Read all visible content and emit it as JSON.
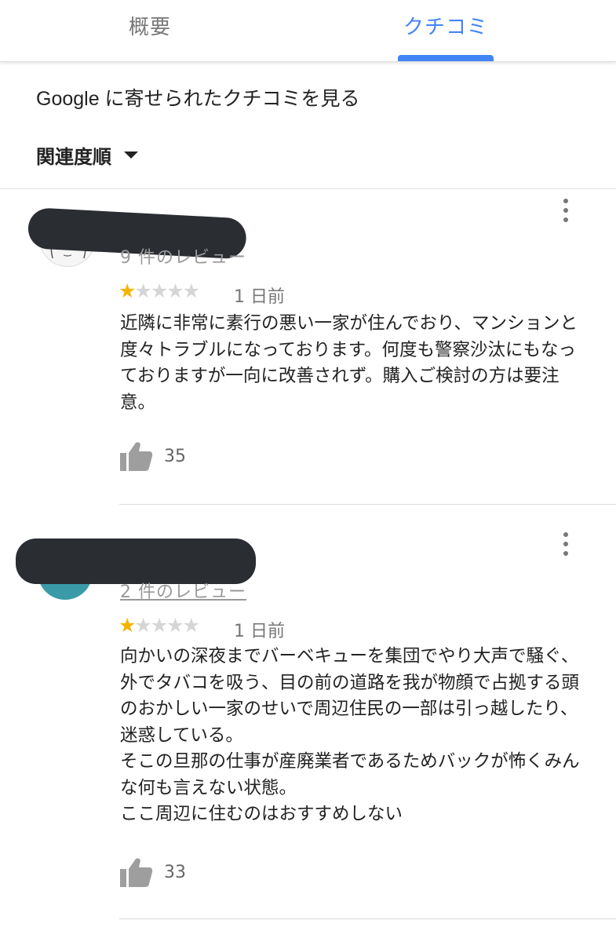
{
  "tabs": [
    {
      "label": "概要"
    },
    {
      "label": "クチコミ"
    }
  ],
  "heading": "Google に寄せられたクチコミを見る",
  "sort": {
    "label": "関連度順"
  },
  "reviews": [
    {
      "review_count": "9 件のレビュー",
      "rating": 1,
      "max_rating": 5,
      "stars_text": {
        "on": "★",
        "off": "★★★★"
      },
      "date": "1 日前",
      "text": "近隣に非常に素行の悪い一家が住んでおり、マンションと度々トラブルになっております。何度も警察沙汰にもなっておりますが一向に改善されず。購入ご検討の方は要注意。",
      "likes": "35"
    },
    {
      "review_count": "2 件のレビュー",
      "rating": 1,
      "max_rating": 5,
      "stars_text": {
        "on": "★",
        "off": "★★★★"
      },
      "date": "1 日前",
      "text": "向かいの深夜までバーベキューを集団でやり大声で騒ぐ、外でタバコを吸う、目の前の道路を我が物顔で占拠する頭のおかしい一家のせいで周辺住民の一部は引っ越したり、迷惑している。\nそこの旦那の仕事が産廃業者であるためバックが怖くみんな何も言えない状態。\nここ周辺に住むのはおすすめしない",
      "likes": "33"
    }
  ],
  "colors": {
    "accent": "#4285f4",
    "star": "#f4b400",
    "redaction": "#2a2d32",
    "avatar_2": "#3a9aa8"
  }
}
